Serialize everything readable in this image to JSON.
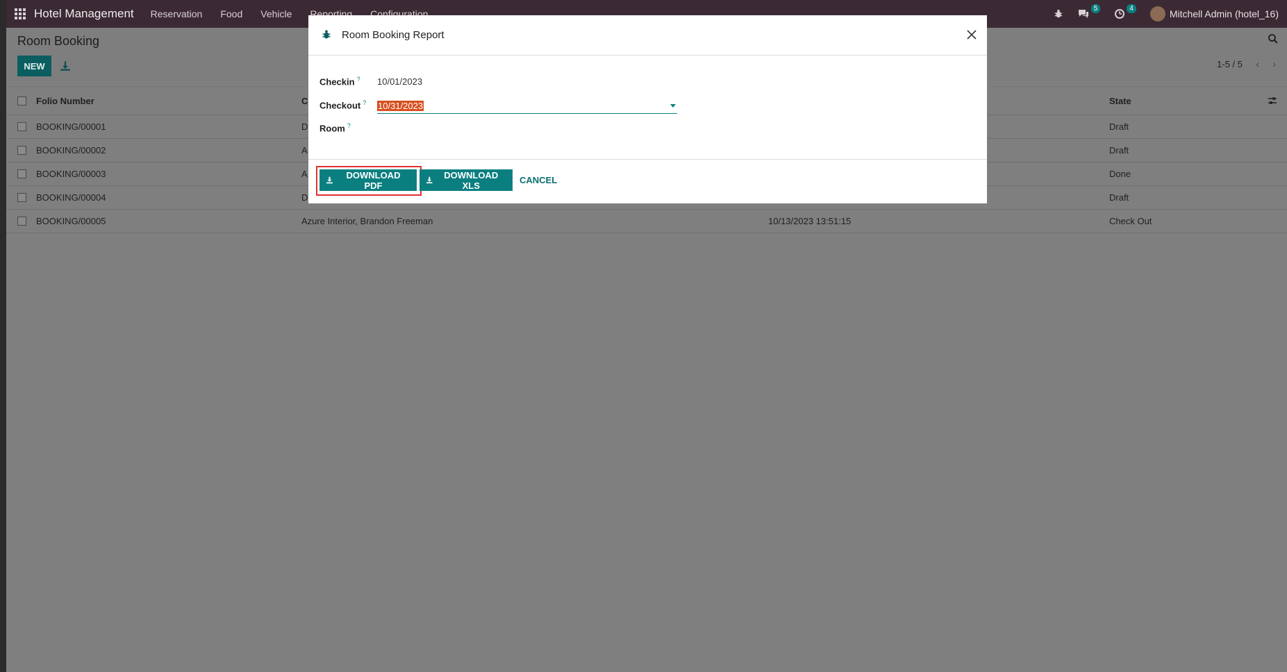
{
  "navbar": {
    "brand": "Hotel Management",
    "menu": [
      "Reservation",
      "Food",
      "Vehicle",
      "Reporting",
      "Configuration"
    ],
    "messages_count": "5",
    "activities_count": "4",
    "user": "Mitchell Admin (hotel_16)"
  },
  "control_panel": {
    "breadcrumb": "Room Booking",
    "new_label": "NEW",
    "pager": "1-5 / 5",
    "pager_prev": "‹",
    "pager_next": "›"
  },
  "list": {
    "headers": [
      "Folio Number",
      "C",
      "State"
    ],
    "rows": [
      {
        "folio": "BOOKING/00001",
        "customer": "D",
        "date": "",
        "state": "Draft"
      },
      {
        "folio": "BOOKING/00002",
        "customer": "A",
        "date": "",
        "state": "Draft"
      },
      {
        "folio": "BOOKING/00003",
        "customer": "A",
        "date": "",
        "state": "Done"
      },
      {
        "folio": "BOOKING/00004",
        "customer": "D",
        "date": "",
        "state": "Draft"
      },
      {
        "folio": "BOOKING/00005",
        "customer": "Azure Interior, Brandon Freeman",
        "date": "10/13/2023 13:51:15",
        "state": "Check Out"
      }
    ]
  },
  "modal": {
    "title": "Room Booking Report",
    "checkin_label": "Checkin",
    "checkin_value": "10/01/2023",
    "checkout_label": "Checkout",
    "checkout_value": "10/31/2023",
    "room_label": "Room",
    "help_mark": "?",
    "download_pdf": "DOWNLOAD PDF",
    "download_xls": "DOWNLOAD XLS",
    "cancel": "CANCEL"
  },
  "colors": {
    "navbar": "#3b2a34",
    "primary": "#0b7f80",
    "selection": "#d6501f",
    "highlight_border": "#e03131"
  }
}
